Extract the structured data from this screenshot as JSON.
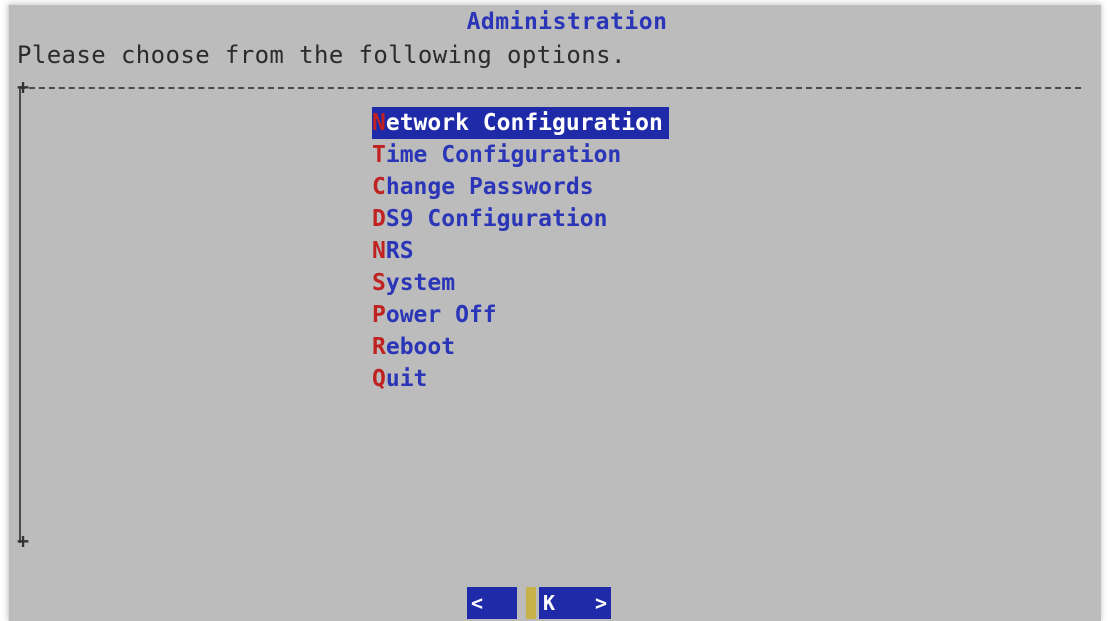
{
  "dialog": {
    "title": "Administration",
    "prompt": "Please choose from the following options."
  },
  "menu": {
    "items": [
      {
        "hotkey": "N",
        "rest": "etwork Configuration",
        "selected": true
      },
      {
        "hotkey": "T",
        "rest": "ime Configuration",
        "selected": false
      },
      {
        "hotkey": "C",
        "rest": "hange Passwords",
        "selected": false
      },
      {
        "hotkey": "D",
        "rest": "S9 Configuration",
        "selected": false
      },
      {
        "hotkey": "N",
        "rest": "RS",
        "selected": false
      },
      {
        "hotkey": "S",
        "rest": "ystem",
        "selected": false
      },
      {
        "hotkey": "P",
        "rest": "ower Off",
        "selected": false
      },
      {
        "hotkey": "R",
        "rest": "eboot",
        "selected": false
      },
      {
        "hotkey": "Q",
        "rest": "uit",
        "selected": false
      }
    ]
  },
  "buttons": {
    "ok_label": "<",
    "cancel_left": "K",
    "cancel_right": ">"
  },
  "colors": {
    "background": "#bcbcbc",
    "title_text": "#2a35b8",
    "hotkey": "#c02222",
    "selection": "#1e2aa8"
  }
}
